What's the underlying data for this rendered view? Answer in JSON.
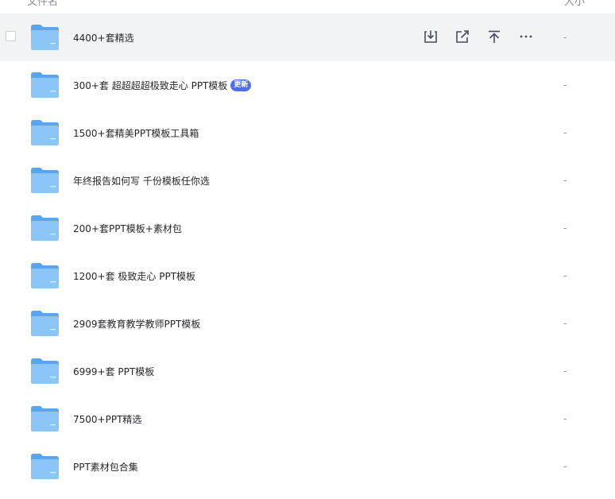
{
  "header": {
    "name_column": "文件名",
    "size_column": "大小"
  },
  "files": [
    {
      "name": "4400+套精选",
      "size": "-",
      "badge": "",
      "hovered": true
    },
    {
      "name": "300+套 超超超超极致走心 PPT模板",
      "size": "-",
      "badge": "更新",
      "hovered": false
    },
    {
      "name": "1500+套精美PPT模板工具箱",
      "size": "-",
      "badge": "",
      "hovered": false
    },
    {
      "name": "年终报告如何写 千份模板任你选",
      "size": "-",
      "badge": "",
      "hovered": false
    },
    {
      "name": "200+套PPT模板+素材包",
      "size": "-",
      "badge": "",
      "hovered": false
    },
    {
      "name": "1200+套 极致走心 PPT模板",
      "size": "-",
      "badge": "",
      "hovered": false
    },
    {
      "name": "2909套教育教学教师PPT模板",
      "size": "-",
      "badge": "",
      "hovered": false
    },
    {
      "name": "6999+套 PPT模板",
      "size": "-",
      "badge": "",
      "hovered": false
    },
    {
      "name": "7500+PPT精选",
      "size": "-",
      "badge": "",
      "hovered": false
    },
    {
      "name": "PPT素材包合集",
      "size": "-",
      "badge": "",
      "hovered": false
    }
  ],
  "row_actions": [
    {
      "icon": "download-icon"
    },
    {
      "icon": "share-icon"
    },
    {
      "icon": "move-top-icon"
    },
    {
      "icon": "more-icon"
    }
  ],
  "colors": {
    "folder_back": "#5ba4ee",
    "folder_front": "#8cc5f7",
    "hover_bg": "#f2f3f5",
    "badge_bg": "#4e6ef2",
    "icon_color": "#454d5a"
  }
}
